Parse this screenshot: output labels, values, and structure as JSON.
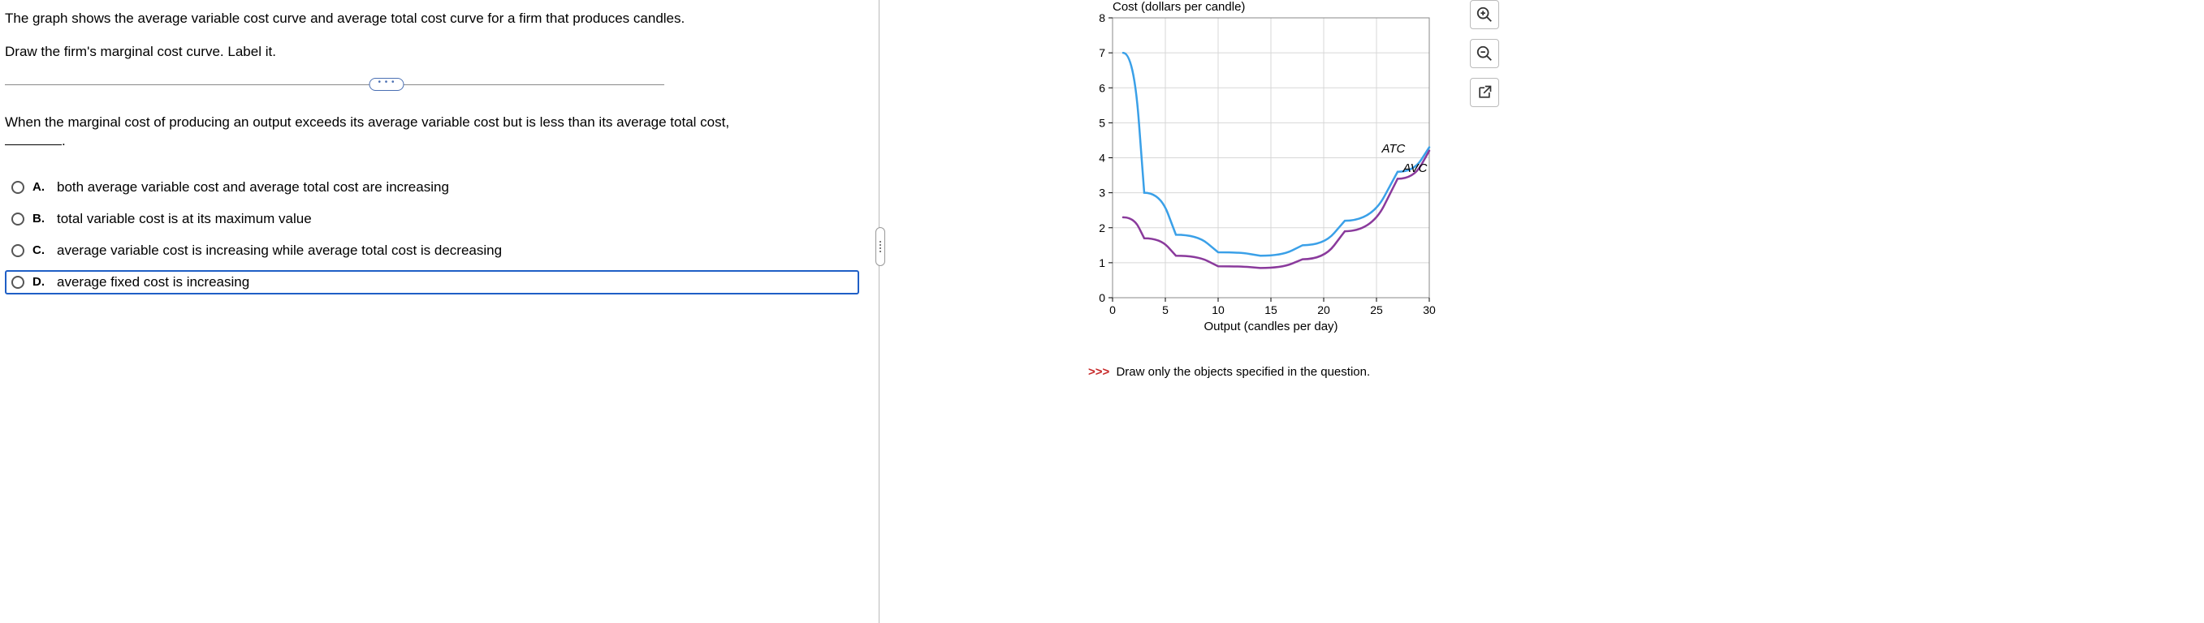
{
  "instructions": {
    "p1": "The graph shows the average variable cost curve and average total cost curve for a firm that produces candles.",
    "p2": "Draw the firm's marginal cost curve. Label it."
  },
  "question_stem": "When the marginal cost of producing an output exceeds its average variable cost but is less than its average total cost,",
  "options": [
    {
      "letter": "A.",
      "text": "both average variable cost and average total cost are increasing",
      "selected": false
    },
    {
      "letter": "B.",
      "text": "total variable cost is at its maximum value",
      "selected": false
    },
    {
      "letter": "C.",
      "text": "average variable cost is increasing while average total cost is decreasing",
      "selected": false
    },
    {
      "letter": "D.",
      "text": "average fixed cost is increasing",
      "selected": true
    }
  ],
  "divider_more": "• • •",
  "chart_data": {
    "type": "line",
    "title": "Cost (dollars per candle)",
    "xlabel": "Output (candles per day)",
    "ylabel": "",
    "xlim": [
      0,
      30
    ],
    "ylim": [
      0,
      8
    ],
    "x_ticks": [
      0,
      5,
      10,
      15,
      20,
      25,
      30
    ],
    "y_ticks": [
      0,
      1,
      2,
      3,
      4,
      5,
      6,
      7,
      8
    ],
    "x": [
      1,
      3,
      6,
      10,
      14,
      18,
      22,
      27,
      30
    ],
    "series": [
      {
        "name": "ATC",
        "color": "#3aa0e8",
        "values": [
          7.0,
          3.0,
          1.8,
          1.3,
          1.2,
          1.5,
          2.2,
          3.6,
          4.3
        ]
      },
      {
        "name": "AVC",
        "color": "#8a3a9c",
        "values": [
          2.3,
          1.7,
          1.2,
          0.9,
          0.85,
          1.1,
          1.9,
          3.4,
          4.2
        ]
      }
    ],
    "series_label_pos": {
      "ATC": {
        "x": 25.5,
        "y": 4.15
      },
      "AVC": {
        "x": 27.5,
        "y": 3.6
      }
    }
  },
  "hint": {
    "arrows": ">>>",
    "text": "Draw only the objects specified in the question."
  }
}
